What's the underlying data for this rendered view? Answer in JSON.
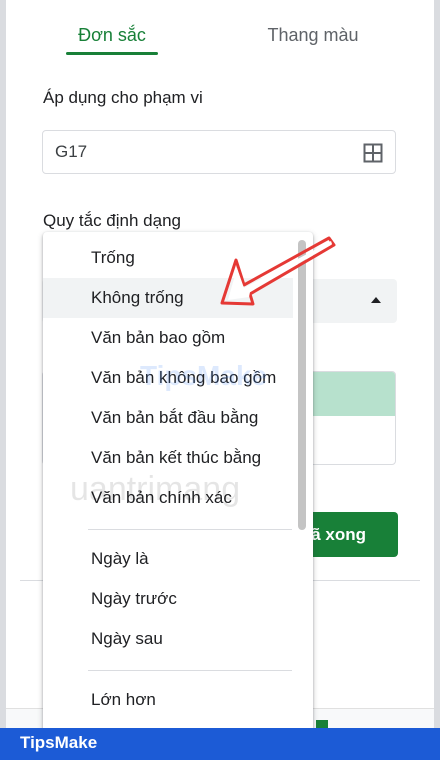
{
  "tabs": {
    "single_color": "Đơn sắc",
    "color_scale": "Thang màu"
  },
  "range": {
    "label": "Áp dụng cho phạm vi",
    "value": "G17",
    "icon": "grid-select-icon"
  },
  "rules": {
    "label": "Quy tắc định dạng"
  },
  "done_button": {
    "label": "ã xong"
  },
  "dropdown": {
    "highlighted_index": 1,
    "group1": [
      "Trống",
      "Không trống",
      "Văn bản bao gồm",
      "Văn bản không bao gồm",
      "Văn bản bắt đầu bằng",
      "Văn bản kết thúc bằng",
      "Văn bản chính xác"
    ],
    "group2": [
      "Ngày là",
      "Ngày trước",
      "Ngày sau"
    ],
    "group3": [
      "Lớn hơn"
    ]
  },
  "watermark": {
    "top": "TipsMake",
    "bottom": "uantrimang"
  },
  "brand": {
    "name": "TipsMake"
  },
  "colors": {
    "accent": "#188038",
    "arrow": "#e53935",
    "brand_bar": "#1c5bd6",
    "preview_fill": "#b7e1cd"
  }
}
